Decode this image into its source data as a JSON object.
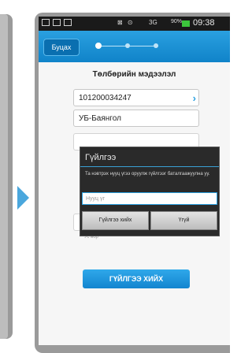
{
  "statusbar": {
    "time": "09:38",
    "battery": "90%",
    "network": "3G"
  },
  "topbar": {
    "back_label": "Буцах"
  },
  "page": {
    "title": "Төлбөрийн мэдээлэл"
  },
  "form": {
    "account_number": "101200034247",
    "branch": "УБ-Баянгол",
    "partial_label": "Ус вор"
  },
  "dialog": {
    "title": "Гүйлгээ",
    "message": "Та нэвтрэх нууц үгээ оруулж гүйлгээг баталгаажуулна уу.",
    "password_placeholder": "Нууц үг",
    "confirm_label": "Гүйлгээ хийх",
    "cancel_label": "Үгүй"
  },
  "actions": {
    "pay_label": "ГҮЙЛГЭЭ ХИЙХ"
  },
  "colors": {
    "accent": "#1a93d8",
    "arrow": "#4aa7dd",
    "dialog_bg": "#2a2a2a"
  }
}
